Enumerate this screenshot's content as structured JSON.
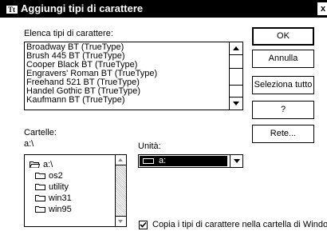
{
  "window": {
    "title": "Aggiungi tipi di carattere",
    "close_label": "x",
    "title_icon": "fonts-folder-icon"
  },
  "font_list": {
    "label": "Elenca tipi di carattere:",
    "items": [
      "Broadway BT (TrueType)",
      "Brush 445 BT (TrueType)",
      "Cooper Black BT (TrueType)",
      "Engravers' Roman BT (TrueType)",
      "Freehand 521 BT (TrueType)",
      "Handel Gothic BT (TrueType)",
      "Kaufmann BT (TrueType)"
    ]
  },
  "buttons": {
    "ok": "OK",
    "cancel": "Annulla",
    "select_all": "Seleziona tutto",
    "help": "?",
    "network": "Rete..."
  },
  "folders": {
    "label": "Cartelle:",
    "current_path": "a:\\",
    "items": [
      "a:\\",
      "os2",
      "utility",
      "win31",
      "win95"
    ]
  },
  "drive": {
    "label": "Unità:",
    "selected": "a:",
    "icon": "floppy-drive-icon"
  },
  "copy_option": {
    "label": "Copia i tipi di carattere nella cartella di Windows",
    "checked": true
  }
}
